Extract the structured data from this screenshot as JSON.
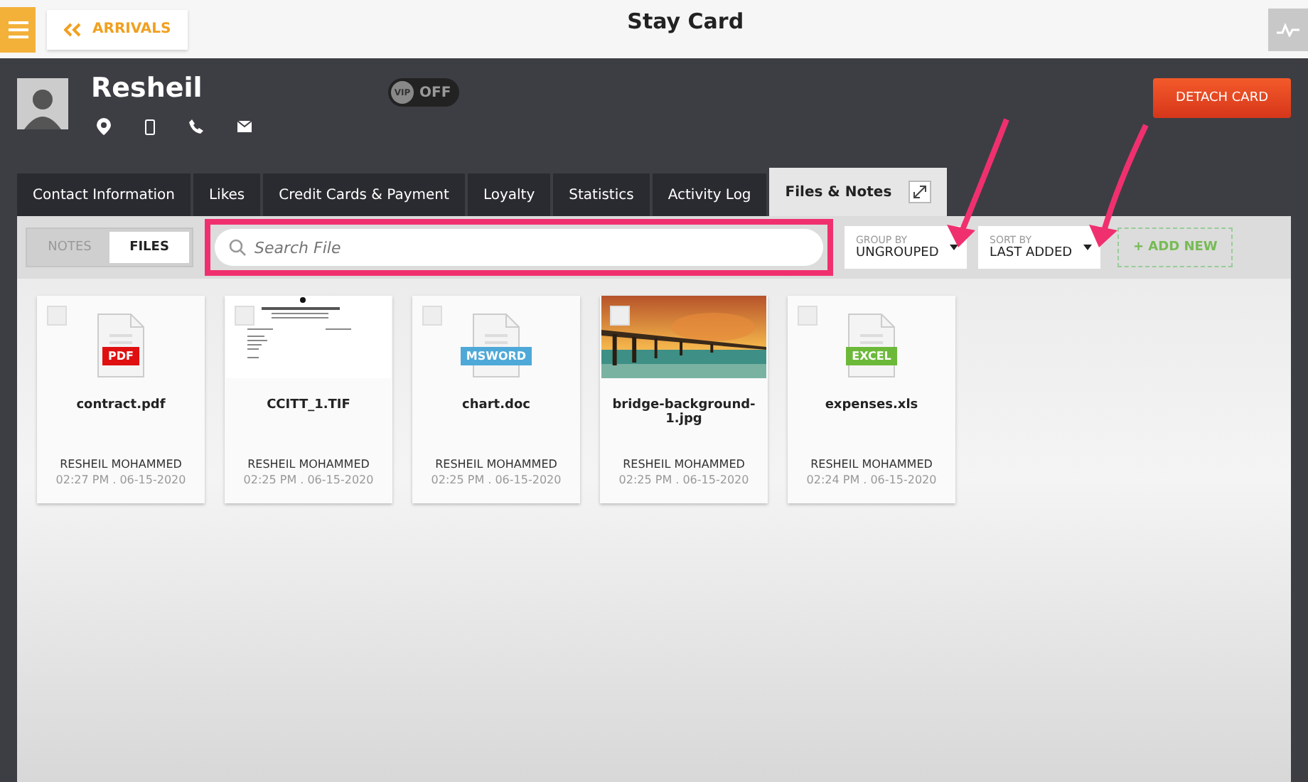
{
  "topbar": {
    "back_label": "ARRIVALS",
    "title": "Stay Card"
  },
  "guest": {
    "name": "Resheil",
    "vip": {
      "label": "VIP",
      "state": "OFF",
      "on": false
    },
    "action": "DETACH CARD"
  },
  "tabs": [
    {
      "label": "Contact Information",
      "selected": false
    },
    {
      "label": "Likes",
      "selected": false
    },
    {
      "label": "Credit Cards & Payment",
      "selected": false
    },
    {
      "label": "Loyalty",
      "selected": false
    },
    {
      "label": "Statistics",
      "selected": false
    },
    {
      "label": "Activity Log",
      "selected": false
    },
    {
      "label": "Files & Notes",
      "selected": true
    }
  ],
  "view_toggle": [
    {
      "label": "NOTES",
      "selected": false
    },
    {
      "label": "FILES",
      "selected": true
    }
  ],
  "search": {
    "placeholder": "Search File",
    "highlighted": true
  },
  "group_by": {
    "label": "GROUP BY",
    "value": "UNGROUPED"
  },
  "sort_by": {
    "label": "SORT BY",
    "value": "LAST ADDED"
  },
  "add_button": "+ ADD NEW",
  "files": [
    {
      "kind": "icon",
      "badge": "PDF",
      "color": "#e01010",
      "name": "contract.pdf",
      "owner": "RESHEIL MOHAMMED",
      "time": "02:27 PM . 06-15-2020",
      "checked": false
    },
    {
      "kind": "document",
      "name": "CCITT_1.TIF",
      "owner": "RESHEIL MOHAMMED",
      "time": "02:25 PM . 06-15-2020",
      "checked": false
    },
    {
      "kind": "icon",
      "badge": "MSWORD",
      "color": "#4ea9d8",
      "name": "chart.doc",
      "owner": "RESHEIL MOHAMMED",
      "time": "02:25 PM . 06-15-2020",
      "checked": false
    },
    {
      "name": "bridge-background-1.jpg",
      "owner": "RESHEIL MOHAMMED",
      "time": "02:25 PM . 06-15-2020",
      "checked": false
    },
    {
      "kind": "icon",
      "badge": "EXCEL",
      "color": "#6cb93a",
      "name": "expenses.xls",
      "owner": "RESHEIL MOHAMMED",
      "time": "02:24 PM . 06-15-2020",
      "checked": false
    }
  ]
}
